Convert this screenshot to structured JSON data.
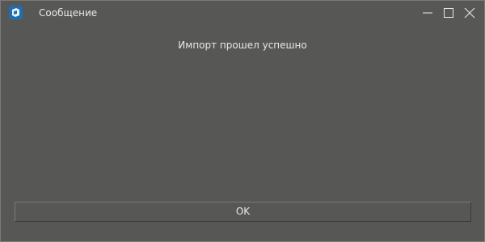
{
  "window": {
    "title": "Сообщение",
    "icon": "app-icon",
    "controls": [
      "minimize-icon",
      "maximize-icon",
      "close-icon"
    ],
    "background": "#575755",
    "text_color": "#e8e8e8",
    "accent": "#1f6fb0"
  },
  "dialog": {
    "message": "Импорт прошел успешно",
    "ok_label": "OK"
  }
}
